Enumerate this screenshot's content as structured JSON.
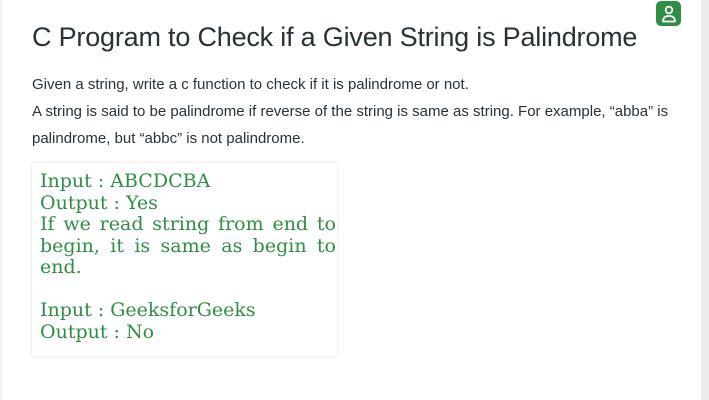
{
  "article": {
    "title": "C Program to Check if a Given String is Palindrome",
    "description_lines": [
      "Given a string, write a c function to check if it is palindrome or not.",
      "A string is said to be palindrome if reverse of the string is same as string. For example, “abba” is palindrome, but “abbc” is not palindrome."
    ]
  },
  "example": {
    "block1": {
      "input": "Input : ABCDCBA",
      "output": "Output : Yes",
      "explanation": "If we read string from end to begin, it is same as begin to end."
    },
    "block2": {
      "input": "Input : GeeksforGeeks",
      "output": "Output : No"
    }
  },
  "header": {
    "profile_icon": "user-profile-icon",
    "accent_color": "#2f8d46"
  }
}
